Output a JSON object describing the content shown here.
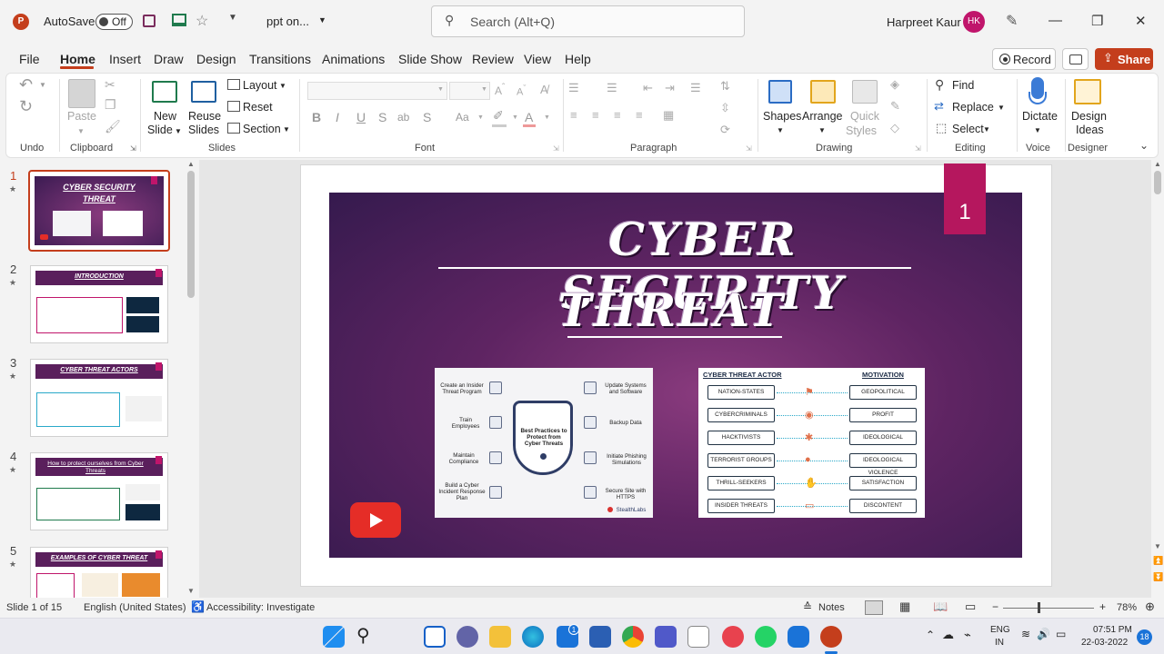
{
  "titlebar": {
    "autosave_label": "AutoSave",
    "autosave_state": "Off",
    "filename": "ppt on...",
    "search_placeholder": "Search (Alt+Q)",
    "user_name": "Harpreet Kaur",
    "user_initials": "HK"
  },
  "tabs": [
    "File",
    "Home",
    "Insert",
    "Draw",
    "Design",
    "Transitions",
    "Animations",
    "Slide Show",
    "Review",
    "View",
    "Help"
  ],
  "active_tab": "Home",
  "actions": {
    "record": "Record",
    "share": "Share"
  },
  "ribbon": {
    "undo_group": "Undo",
    "clipboard": {
      "paste": "Paste",
      "group": "Clipboard"
    },
    "slides": {
      "new_slide_1": "New",
      "new_slide_2": "Slide",
      "reuse_1": "Reuse",
      "reuse_2": "Slides",
      "layout": "Layout",
      "reset": "Reset",
      "section": "Section",
      "group": "Slides"
    },
    "font": {
      "group": "Font",
      "bold": "B",
      "italic": "I",
      "underline": "U",
      "strike": "S",
      "spacing": "ab",
      "case": "Aa"
    },
    "paragraph": {
      "group": "Paragraph"
    },
    "drawing": {
      "shapes": "Shapes",
      "arrange": "Arrange",
      "quick_1": "Quick",
      "quick_2": "Styles",
      "group": "Drawing"
    },
    "editing": {
      "find": "Find",
      "replace": "Replace",
      "select": "Select",
      "group": "Editing"
    },
    "voice": {
      "dictate": "Dictate",
      "group": "Voice"
    },
    "designer": {
      "ideas_1": "Design",
      "ideas_2": "Ideas",
      "group": "Designer"
    }
  },
  "thumbnails": [
    {
      "num": "1",
      "title": "CYBER SECURITY THREAT"
    },
    {
      "num": "2",
      "title": "INTRODUCTION"
    },
    {
      "num": "3",
      "title": "CYBER THREAT ACTORS"
    },
    {
      "num": "4",
      "title": "How to protect ourselves from Cyber Threats"
    },
    {
      "num": "5",
      "title": "EXAMPLES OF CYBER THREAT"
    }
  ],
  "slide": {
    "title_line1": "CYBER SECURITY",
    "title_line2": "THREAT",
    "slide_number": "1",
    "best_practices": {
      "center": "Best Practices to Protect from Cyber Threats",
      "items": [
        "Create an Insider Threat Program",
        "Train Employees",
        "Maintain Compliance",
        "Build a Cyber Incident Response Plan",
        "Update Systems and Software",
        "Backup Data",
        "Initiate Phishing Simulations",
        "Secure Site with HTTPS"
      ],
      "brand": "StealthLabs"
    },
    "actors_table": {
      "header_actor": "CYBER THREAT ACTOR",
      "header_motivation": "MOTIVATION",
      "rows": [
        {
          "actor": "NATION-STATES",
          "motivation": "GEOPOLITICAL"
        },
        {
          "actor": "CYBERCRIMINALS",
          "motivation": "PROFIT"
        },
        {
          "actor": "HACKTIVISTS",
          "motivation": "IDEOLOGICAL"
        },
        {
          "actor": "TERRORIST GROUPS",
          "motivation": "IDEOLOGICAL VIOLENCE"
        },
        {
          "actor": "THRILL-SEEKERS",
          "motivation": "SATISFACTION"
        },
        {
          "actor": "INSIDER THREATS",
          "motivation": "DISCONTENT"
        }
      ]
    }
  },
  "status": {
    "slide_info": "Slide 1 of 15",
    "language": "English (United States)",
    "accessibility": "Accessibility: Investigate",
    "notes": "Notes",
    "zoom": "78%"
  },
  "taskbar": {
    "lang_1": "ENG",
    "lang_2": "IN",
    "time": "07:51 PM",
    "date": "22-03-2022",
    "notif": "18",
    "mail_badge": "1"
  },
  "colors": {
    "accent": "#c43e1c",
    "slide_bg": "#5e2462",
    "magenta": "#b5175e"
  }
}
